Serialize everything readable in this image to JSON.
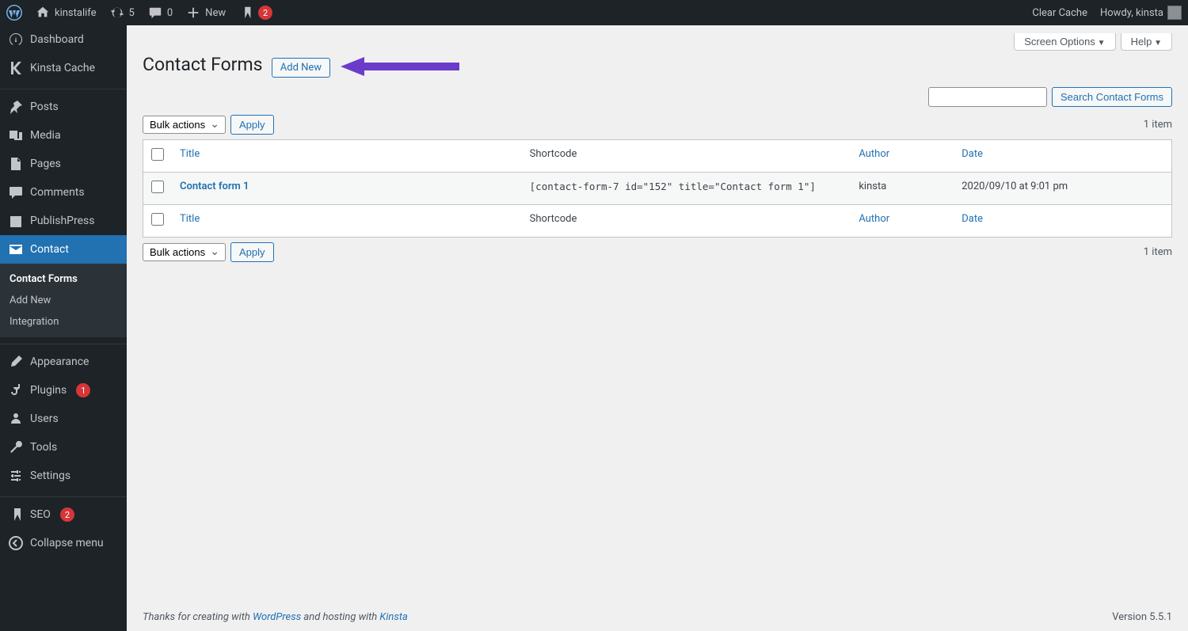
{
  "adminbar": {
    "site_name": "kinstalife",
    "updates": "5",
    "comments": "0",
    "new_label": "New",
    "yoast_badge": "2",
    "clear_cache": "Clear Cache",
    "howdy": "Howdy, kinsta"
  },
  "sidebar": {
    "dashboard": "Dashboard",
    "kinsta_cache": "Kinsta Cache",
    "posts": "Posts",
    "media": "Media",
    "pages": "Pages",
    "comments": "Comments",
    "publishpress": "PublishPress",
    "contact": "Contact",
    "sub_contact_forms": "Contact Forms",
    "sub_add_new": "Add New",
    "sub_integration": "Integration",
    "appearance": "Appearance",
    "plugins": "Plugins",
    "plugins_badge": "1",
    "users": "Users",
    "tools": "Tools",
    "settings": "Settings",
    "seo": "SEO",
    "seo_badge": "2",
    "collapse": "Collapse menu"
  },
  "screen": {
    "options": "Screen Options",
    "help": "Help"
  },
  "page": {
    "title": "Contact Forms",
    "add_new": "Add New",
    "search_btn": "Search Contact Forms",
    "bulk_actions": "Bulk actions",
    "apply": "Apply",
    "count": "1 item"
  },
  "table": {
    "title": "Title",
    "shortcode": "Shortcode",
    "author": "Author",
    "date": "Date",
    "row": {
      "title": "Contact form 1",
      "shortcode": "[contact-form-7 id=\"152\" title=\"Contact form 1\"]",
      "author": "kinsta",
      "date": "2020/09/10 at 9:01 pm"
    }
  },
  "footer": {
    "pre": "Thanks for creating with ",
    "wp": "WordPress",
    "mid": " and hosting with ",
    "kinsta": "Kinsta",
    "version": "Version 5.5.1"
  }
}
